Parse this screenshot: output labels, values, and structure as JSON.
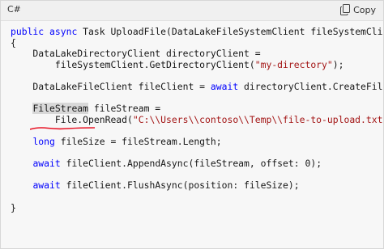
{
  "header": {
    "language": "C#",
    "copy_label": "Copy",
    "copy_icon": "copy-icon"
  },
  "code": {
    "l1_kw1": "public",
    "l1_kw2": "async",
    "l1_rest": " Task UploadFile(DataLakeFileSystemClient fileSystemClient)",
    "l2": "{",
    "l3": "    DataLakeDirectoryClient directoryClient =",
    "l4_pre": "        fileSystemClient.GetDirectoryClient(",
    "l4_str": "\"my-directory\"",
    "l4_post": ");",
    "l6_pre": "    DataLakeFileClient fileClient = ",
    "l6_kw": "await",
    "l6_post": " directoryClient.CreateFileAsync(\"uploaded-file.txt\");",
    "l8_hl": "FileStream",
    "l8_post": " fileStream =",
    "l9_pre": "        File.OpenRead(",
    "l9_str": "\"C:\\\\Users\\\\contoso\\\\Temp\\\\file-to-upload.txt\"",
    "l9_post": ");",
    "l11_kw": "long",
    "l11_post": " fileSize = fileStream.Length;",
    "l13_kw": "await",
    "l13_post": " fileClient.AppendAsync(fileStream, offset: 0);",
    "l15_kw": "await",
    "l15_post": " fileClient.FlushAsync(position: fileSize);",
    "l17": "}"
  },
  "colors": {
    "keyword": "#0101fd",
    "string": "#a31515",
    "squiggle": "#e81123"
  }
}
